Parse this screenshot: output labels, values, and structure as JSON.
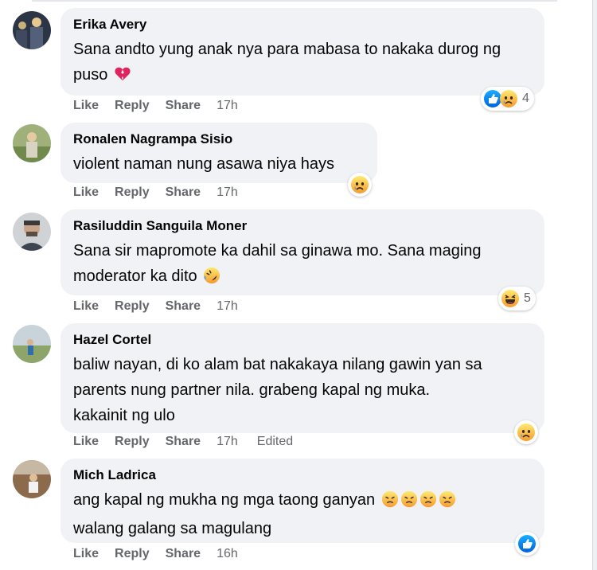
{
  "comments": [
    {
      "author": "Erika Avery",
      "text": "Sana andto yung anak nya para mabasa to nakaka durog ng puso",
      "inline_emoji": "broken-heart",
      "actions": {
        "like": "Like",
        "reply": "Reply",
        "share": "Share"
      },
      "time": "17h",
      "reactions": [
        "like",
        "sad"
      ],
      "reaction_count": "4"
    },
    {
      "author": "Ronalen Nagrampa Sisio",
      "text": "violent naman nung asawa niya hays",
      "actions": {
        "like": "Like",
        "reply": "Reply",
        "share": "Share"
      },
      "time": "17h",
      "reactions": [
        "sad"
      ],
      "reaction_count": ""
    },
    {
      "author": "Rasiluddin Sanguila Moner",
      "text_lines": [
        "Sana sir mapromote ka dahil sa ginawa mo. Sana maging",
        "moderator ka dito"
      ],
      "inline_emoji": "rofl",
      "actions": {
        "like": "Like",
        "reply": "Reply",
        "share": "Share"
      },
      "time": "17h",
      "reactions": [
        "haha"
      ],
      "reaction_count": "5"
    },
    {
      "author": "Hazel Cortel",
      "text_lines": [
        "baliw nayan, di ko alam bat nakakaya nilang gawin yan sa",
        "parents nung partner nila. grabeng kapal ng muka.",
        "kakainit ng ulo"
      ],
      "actions": {
        "like": "Like",
        "reply": "Reply",
        "share": "Share"
      },
      "time": "17h",
      "edited": "Edited",
      "reactions": [
        "sad"
      ],
      "reaction_count": ""
    },
    {
      "author": "Mich Ladrica",
      "text_lines": [
        "ang kapal ng mukha ng mga taong ganyan",
        "walang galang sa magulang"
      ],
      "inline_emoji": "angry x4",
      "actions": {
        "like": "Like",
        "reply": "Reply",
        "share": "Share"
      },
      "time": "16h",
      "reactions": [
        "like"
      ],
      "reaction_count": ""
    }
  ],
  "colors": {
    "bubble": "#f0f2f5",
    "meta_text": "#65676b",
    "like_blue": "#1877f2",
    "emoji_yellow": "#f7b125"
  }
}
